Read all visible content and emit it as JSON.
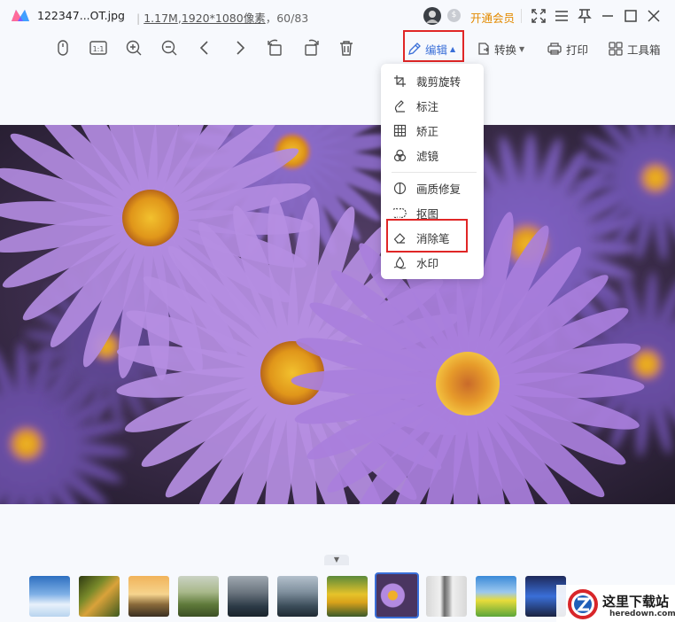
{
  "titlebar": {
    "filename": "122347...OT.jpg",
    "filesize": "1.17M",
    "resolution": "1920*1080像素",
    "position": "60/83",
    "vip_label": "开通会员"
  },
  "toolbar": {
    "edit_label": "编辑",
    "convert_label": "转换",
    "print_label": "打印",
    "toolbox_label": "工具箱"
  },
  "edit_menu": {
    "items": [
      {
        "label": "裁剪旋转",
        "icon": "crop-icon"
      },
      {
        "label": "标注",
        "icon": "annotate-icon"
      },
      {
        "label": "矫正",
        "icon": "grid-icon"
      },
      {
        "label": "滤镜",
        "icon": "filter-icon"
      },
      {
        "label": "画质修复",
        "icon": "repair-icon"
      },
      {
        "label": "抠图",
        "icon": "cutout-icon"
      },
      {
        "label": "消除笔",
        "icon": "eraser-icon"
      },
      {
        "label": "水印",
        "icon": "watermark-icon"
      }
    ]
  },
  "watermark": {
    "zh": "这里下载站",
    "en": "heredown.com"
  },
  "colors": {
    "accent": "#3a6fd8",
    "highlight": "#e02626",
    "vip": "#e38a00",
    "flower": "#a47ad6",
    "flower_center": "#e0a21c"
  }
}
